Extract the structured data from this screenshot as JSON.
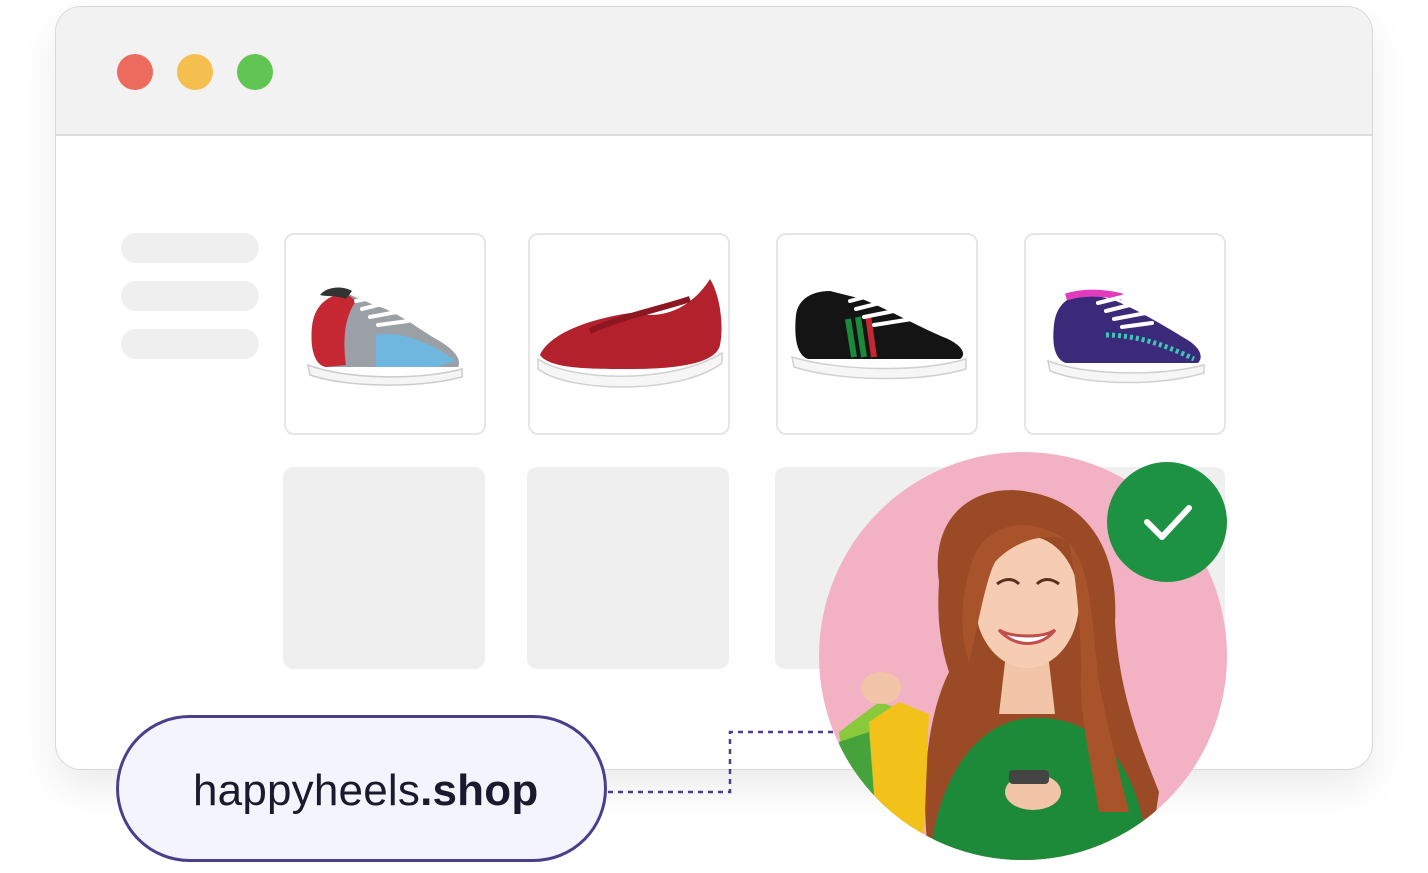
{
  "window": {
    "controls": [
      "close",
      "minimize",
      "maximize"
    ]
  },
  "sidebar": {
    "placeholder_lines": 3
  },
  "products": [
    {
      "name": "grey-blue-red-knit-sneaker",
      "icon": "sneaker-image"
    },
    {
      "name": "red-mary-jane-knit-shoe",
      "icon": "flat-shoe-image"
    },
    {
      "name": "black-sneaker-green-red-stripe",
      "icon": "sneaker-image"
    },
    {
      "name": "purple-pink-knit-sneaker",
      "icon": "sneaker-image"
    }
  ],
  "domain": {
    "name": "happyheels",
    "tld": ".shop"
  },
  "customer": {
    "icon": "shopper-photo",
    "verified_icon": "check-icon"
  },
  "colors": {
    "badge": "#1e9243",
    "pill_border": "#4b3f8c",
    "avatar_bg": "#f2b2c4"
  }
}
